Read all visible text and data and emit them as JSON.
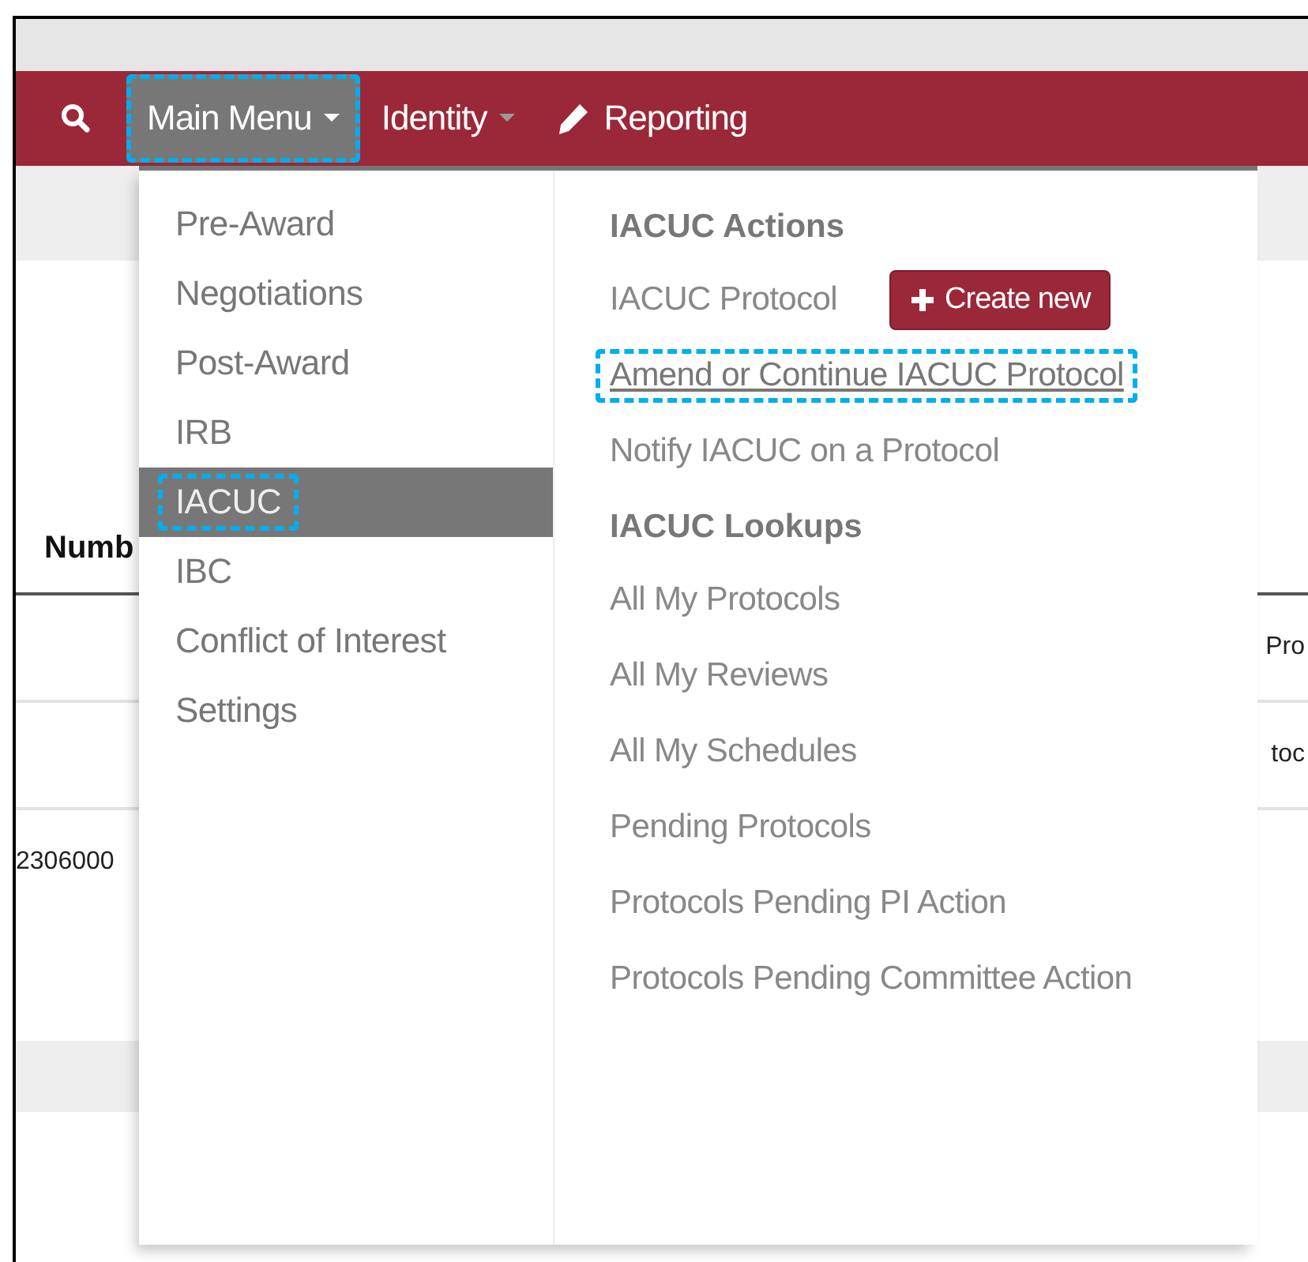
{
  "navbar": {
    "items": [
      {
        "kind": "search"
      },
      {
        "kind": "dropdown",
        "label": "Main Menu",
        "selected": true,
        "highlighted": true
      },
      {
        "kind": "dropdown",
        "label": "Identity",
        "selected": false,
        "highlighted": false
      },
      {
        "kind": "pencil",
        "label": "Reporting",
        "selected": false,
        "highlighted": false
      }
    ]
  },
  "background_table": {
    "header": "Numb",
    "rows": [
      {
        "column_1": "",
        "column_2": "Pro"
      },
      {
        "column_1": "",
        "column_2": "toc"
      },
      {
        "column_1": "2306000",
        "column_2": ""
      }
    ]
  },
  "main_menu": {
    "modules": [
      {
        "label": "Pre-Award",
        "selected": false,
        "highlighted": false
      },
      {
        "label": "Negotiations",
        "selected": false,
        "highlighted": false
      },
      {
        "label": "Post-Award",
        "selected": false,
        "highlighted": false
      },
      {
        "label": "IRB",
        "selected": false,
        "highlighted": false
      },
      {
        "label": "IACUC",
        "selected": true,
        "highlighted": true
      },
      {
        "label": "IBC",
        "selected": false,
        "highlighted": false
      },
      {
        "label": "Conflict of Interest",
        "selected": false,
        "highlighted": false
      },
      {
        "label": "Settings",
        "selected": false,
        "highlighted": false
      }
    ],
    "submenu": [
      {
        "kind": "heading",
        "label": "IACUC Actions"
      },
      {
        "kind": "link",
        "label": "IACUC Protocol",
        "button": "Create new",
        "highlighted": false
      },
      {
        "kind": "link",
        "label": "Amend or Continue IACUC Protocol",
        "highlighted": true
      },
      {
        "kind": "link",
        "label": "Notify IACUC on a Protocol",
        "highlighted": false
      },
      {
        "kind": "heading",
        "label": "IACUC Lookups"
      },
      {
        "kind": "link",
        "label": "All My Protocols",
        "highlighted": false
      },
      {
        "kind": "link",
        "label": "All My Reviews",
        "highlighted": false
      },
      {
        "kind": "link",
        "label": "All My Schedules",
        "highlighted": false
      },
      {
        "kind": "link",
        "label": "Pending Protocols",
        "highlighted": false
      },
      {
        "kind": "link",
        "label": "Protocols Pending PI Action",
        "highlighted": false
      },
      {
        "kind": "link",
        "label": "Protocols Pending Committee Action",
        "highlighted": false
      }
    ]
  }
}
